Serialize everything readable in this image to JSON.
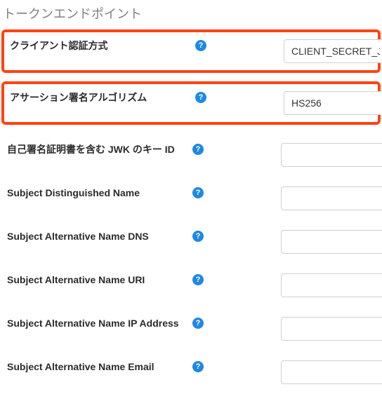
{
  "section_title": "トークンエンドポイント",
  "help_glyph": "?",
  "rows": [
    {
      "label": "クライアント認証方式",
      "value": "CLIENT_SECRET_JWT",
      "highlight": true
    },
    {
      "label": "アサーション署名アルゴリズム",
      "value": "HS256",
      "highlight": true
    },
    {
      "label": "自己署名証明書を含む JWK のキー ID",
      "value": "",
      "highlight": false
    },
    {
      "label": "Subject Distinguished Name",
      "value": "",
      "highlight": false
    },
    {
      "label": "Subject Alternative Name DNS",
      "value": "",
      "highlight": false
    },
    {
      "label": "Subject Alternative Name URI",
      "value": "",
      "highlight": false
    },
    {
      "label": "Subject Alternative Name IP Address",
      "value": "",
      "highlight": false
    },
    {
      "label": "Subject Alternative Name Email",
      "value": "",
      "highlight": false
    }
  ]
}
